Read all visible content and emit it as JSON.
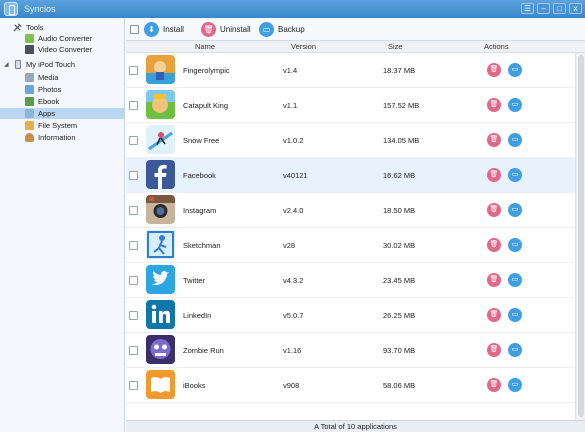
{
  "window": {
    "title": "Syncios",
    "buttons": [
      "☰",
      "–",
      "□",
      "x"
    ]
  },
  "sidebar": {
    "tools_label": "Tools",
    "tools_items": [
      {
        "label": "Audio Converter",
        "icon": "music-note-icon"
      },
      {
        "label": "Video Converter",
        "icon": "film-icon"
      }
    ],
    "device_label": "My iPod Touch",
    "device_items": [
      {
        "label": "Media",
        "icon": "media-icon"
      },
      {
        "label": "Photos",
        "icon": "photos-icon"
      },
      {
        "label": "Ebook",
        "icon": "ebook-icon"
      },
      {
        "label": "Apps",
        "icon": "apps-icon",
        "selected": true
      },
      {
        "label": "File System",
        "icon": "folder-icon"
      },
      {
        "label": "Information",
        "icon": "person-icon"
      }
    ]
  },
  "toolbar": {
    "install_label": "Install",
    "uninstall_label": "Uninstall",
    "backup_label": "Backup"
  },
  "columns": {
    "name": "Name",
    "version": "Version",
    "size": "Size",
    "actions": "Actions"
  },
  "apps": [
    {
      "name": "Fingerolympic",
      "version": "v1.4",
      "size": "18.37 MB",
      "icon": "fingerolympic-app-icon"
    },
    {
      "name": "Catapult King",
      "version": "v1.1",
      "size": "157.52 MB",
      "icon": "catapult-king-app-icon"
    },
    {
      "name": "Snow Free",
      "version": "v1.0.2",
      "size": "134.05 MB",
      "icon": "snow-free-app-icon"
    },
    {
      "name": "Facebook",
      "version": "v40121",
      "size": "16.62 MB",
      "icon": "facebook-app-icon",
      "selected": true
    },
    {
      "name": "Instagram",
      "version": "v2.4.0",
      "size": "18.50 MB",
      "icon": "instagram-app-icon"
    },
    {
      "name": "Sketchman",
      "version": "v28",
      "size": "30.02 MB",
      "icon": "sketchman-app-icon"
    },
    {
      "name": "Twitter",
      "version": "v4.3.2",
      "size": "23.45 MB",
      "icon": "twitter-app-icon"
    },
    {
      "name": "LinkedIn",
      "version": "v5.0.7",
      "size": "26.25 MB",
      "icon": "linkedin-app-icon"
    },
    {
      "name": "Zombie Run",
      "version": "v1.16",
      "size": "93.70 MB",
      "icon": "zombie-run-app-icon"
    },
    {
      "name": "iBooks",
      "version": "v908",
      "size": "58.06 MB",
      "icon": "ibooks-app-icon"
    }
  ],
  "status": {
    "text": "A Total of 10 applications"
  },
  "colors": {
    "titlebar": "#3b86c9",
    "selection": "#b9d6f3",
    "uninstall": "#e2688b",
    "install": "#3f9fe0"
  }
}
